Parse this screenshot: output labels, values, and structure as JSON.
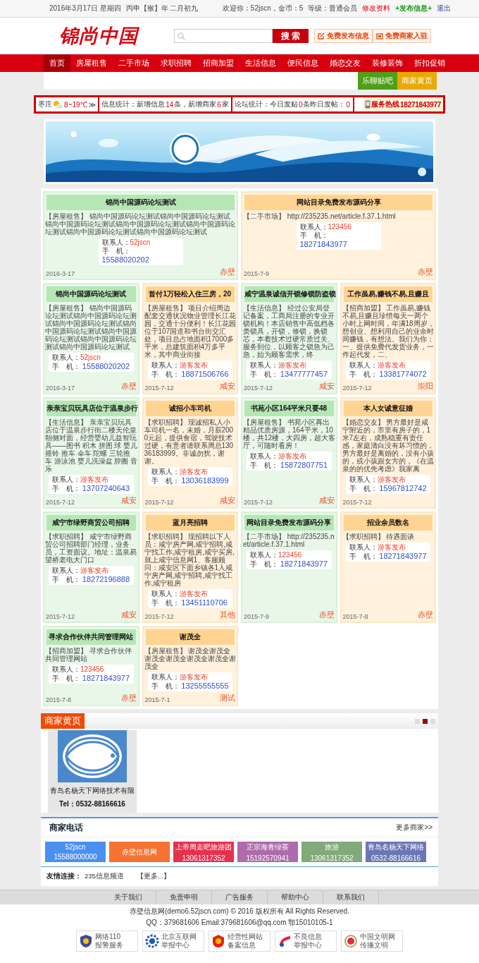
{
  "top_bar": {
    "date": "2016年3月17日 星期四",
    "lunar": "丙申【猴】年 二月初九",
    "welcome": "欢迎你：52jscn，金币：5",
    "level": "等级：普通会员",
    "links": [
      {
        "label": "修改资料",
        "kind": "edit"
      },
      {
        "label": "+发布信息+",
        "kind": "post"
      },
      {
        "label": "退出",
        "kind": "logout"
      }
    ]
  },
  "header": {
    "logo": "锦尚中国",
    "search_button": "搜 索",
    "actions": [
      {
        "label": "免费发布信息",
        "kind": "post"
      },
      {
        "label": "免费商家入驻",
        "kind": "shop"
      }
    ]
  },
  "nav": {
    "items": [
      {
        "label": "首页",
        "selected": true
      },
      {
        "label": "房屋租售",
        "selected": false
      },
      {
        "label": "二手市场",
        "selected": false
      },
      {
        "label": "求职招聘",
        "selected": false
      },
      {
        "label": "招商加盟",
        "selected": false
      },
      {
        "label": "生活信息",
        "selected": false
      },
      {
        "label": "便民信息",
        "selected": false
      },
      {
        "label": "婚恋交友",
        "selected": false
      },
      {
        "label": "装修装饰",
        "selected": false
      },
      {
        "label": "折扣促销",
        "selected": false
      }
    ]
  },
  "subnav": [
    {
      "label": "乐聊贴吧",
      "color": "#4f9f17"
    },
    {
      "label": "商家黄页",
      "color": "#e8aa00"
    }
  ],
  "stats": {
    "city": "枣庄",
    "temperature": "8~19℃",
    "more": "≫",
    "info_label": "信息统计：新增信息",
    "new_info": "14",
    "info_unit": "条，",
    "merchant_label": "新增商家",
    "new_merchants": "6",
    "merchant_unit": "家",
    "forum_label": "论坛统计：今日发贴",
    "today_posts": "0",
    "posts_unit": "条",
    "yesterday_label": "昨日发帖：",
    "yesterday_posts": "0",
    "hotline_label": "服务热线",
    "hotline": "18271843977"
  },
  "cards": [
    {
      "kind": "wide",
      "color": "#b6e6b6",
      "title": "锦尚中国源码论坛测试",
      "category": "【房屋租售】",
      "body": "锦尚中国源码论坛测试锦尚中国源码论坛测试锦尚中国源码论坛测试锦尚中国源码论坛测试锦尚中国源码论坛测试锦尚中国源码论坛测试锦尚中国源码论坛测试",
      "contact_label": "联系人：",
      "contact": "52jscn",
      "phone_label": "手　机：",
      "phone": "15588020202",
      "date": "2016-3-17",
      "area": "赤壁"
    },
    {
      "kind": "wide",
      "color": "#ffd391",
      "title": "网站目录免费发布源码分享",
      "category": "【二手市场】",
      "body": "http://235235.net/article.f.37.1.html",
      "contact_label": "联系人：",
      "contact": "123456",
      "phone_label": "手　机：",
      "phone": "18271843977",
      "date": "2015-7-9",
      "area": "赤壁"
    },
    {
      "kind": "normal",
      "color": "#b6e6b6",
      "title": "锦尚中国源码论坛测试",
      "category": "【房屋租售】",
      "body": "锦尚中国源码论坛测试锦尚中国源码论坛测试锦尚中国源码论坛测试锦尚中国源码论坛测试锦尚中国源码论坛测试锦尚中国源码论坛测试锦尚中国源码论坛测试",
      "contact_label": "联系人：",
      "contact": "52jscn",
      "phone_label": "手　机：",
      "phone": "15588020202",
      "date": "2016-3-17",
      "area": "赤壁"
    },
    {
      "kind": "normal",
      "color": "#ffd391",
      "title": "首付1万轻松入住三房，20",
      "category": "【房屋租售】",
      "body": "项目介绍周边配套交通状况物业管理长江花园，交通十分便利！长江花园位于107国道和书台街交汇处，项目总占地面积17000多平米，总建筑面积4万多平米，其中商业街接",
      "contact_label": "联系人：",
      "contact": "游客发布",
      "phone_label": "手　机：",
      "phone": "18871506766",
      "date": "2015-7-12",
      "area": "咸安"
    },
    {
      "kind": "normal",
      "color": "#b6e6b6",
      "title": "咸宁温泉诚信开锁修锁防盗锁",
      "category": "【生活信息】",
      "body": "经过公安局登记备案，工商局注册的专业开锁机构！本店销售中高低档各类锁具，开锁，修锁，换锁芯，本着技术过硬常质过关、服务到位，以顾客之锁急为己急，始为顾客需求，终",
      "contact_label": "联系人：",
      "contact": "游客发布",
      "phone_label": "手　机：",
      "phone": "13477777457",
      "date": "2015-7-12",
      "area": "咸安"
    },
    {
      "kind": "normal",
      "color": "#ffd391",
      "title": "工作虽易,赚钱不易,且赚且",
      "category": "【招商加盟】",
      "body": "工作虽易,赚钱不易,且赚且珍惜每天一两个小时上网时间，年满18周岁，想创业、想利用自己的业余时间赚钱，有想法。我们为你：一、提供免费代发货业务，一件起代发，二、",
      "contact_label": "联系人：",
      "contact": "游客发布",
      "phone_label": "手　机：",
      "phone": "13381774072",
      "date": "2015-7-12",
      "area": "崇阳"
    },
    {
      "kind": "normal",
      "color": "#b6e6b6",
      "title": "亲亲宝贝玩具店位于温泉步行",
      "category": "【生活信息】",
      "body": "亲亲宝贝玩具店位于温泉步行街二楼天伦皇朝侧对面，经营婴幼儿益智玩具——图书 积木 拼图 球 婴儿摇铃 推车 伞车 陀螺 三轮推车 游泳池 婴儿洗澡盆 脖圈 音乐",
      "contact_label": "联系人：",
      "contact": "游客发布",
      "phone_label": "手　机：",
      "phone": "13707240643",
      "date": "2015-7-12",
      "area": "咸安"
    },
    {
      "kind": "normal",
      "color": "#ffd391",
      "title": "诚招小车司机",
      "category": "【求职招聘】",
      "body": "现诚招私人小车司机一名，未婚，月薪2000元起，提供食宿，驾驶技术过硬，有意者请联系周总13036183999。非诚勿扰，谢谢。",
      "contact_label": "联系人：",
      "contact": "游客发布",
      "phone_label": "手　机：",
      "phone": "13036183999",
      "date": "2015-7-12",
      "area": "咸安"
    },
    {
      "kind": "normal",
      "color": "#b6e6b6",
      "title": "书苑小区164平米只要48",
      "category": "【房屋租售】",
      "body": "书苑小区再出精品优质房源，164平米，10楼，共12楼，大四房，超大客厅，可随时看房！",
      "contact_label": "联系人：",
      "contact": "游客发布",
      "phone_label": "手　机：",
      "phone": "15872807751",
      "date": "2015-7-12",
      "area": "咸安"
    },
    {
      "kind": "normal",
      "color": "#ffd391",
      "title": "本人女诚意征婚",
      "category": "【婚恋交友】",
      "body": "男方最好是咸宁附近的，市里有房子的，1米7左右，成熟稳重有责任感，家庭清白没有坏习惯的，男方最好是离婚的，没有小孩的，或小孩跟女方的，《在温泉的的优先考虑》我家离",
      "contact_label": "联系人：",
      "contact": "游客发布",
      "phone_label": "手　机：",
      "phone": "15967812742",
      "date": "2015-7-12"
    },
    {
      "kind": "normal",
      "color": "#b6e6b6",
      "title": "咸宁市绿野商贸公司招聘",
      "category": "【求职招聘】",
      "body": "咸宁市绿野商贸公司招聘部门经理，业务员，工资面议。地址：温泉易望桥老电大门口",
      "contact_label": "联系人：",
      "contact": "游客发布",
      "phone_label": "手　机：",
      "phone": "18272196888",
      "date": "2015-7-12",
      "area": "咸安"
    },
    {
      "kind": "normal",
      "color": "#ffd391",
      "title": "蓝月亮招聘",
      "category": "【求职招聘】",
      "body": "现招聘以下人员：咸宁房产网,咸宁招聘,咸宁找工作,咸宁租房,咸宁买房,就上咸宁信息网1、客服顾问：咸安区下面乡镇各1人咸宁房产网,咸宁招聘,咸宁找工作,咸宁租房",
      "contact_label": "联系人：",
      "contact": "游客发布",
      "phone_label": "手　机：",
      "phone": "13451110706",
      "date": "2015-7-12",
      "area": "其他"
    },
    {
      "kind": "normal",
      "color": "#b6e6b6",
      "title": "网站目录免费发布源码分享",
      "category": "【二手市场】",
      "body": "http://235235.net/article.f.37.1.html",
      "contact_label": "联系人：",
      "contact": "123456",
      "phone_label": "手　机：",
      "phone": "18271843977",
      "date": "2015-7-9",
      "area": "赤壁"
    },
    {
      "kind": "normal",
      "color": "#ffd391",
      "title": "招业余员数名",
      "category": "【求职招聘】",
      "body": "待遇面谈",
      "contact_label": "联系人：",
      "contact": "游客发布",
      "phone_label": "手　机：",
      "phone": "18271843977",
      "date": "2015-7-8",
      "area": "赤壁"
    },
    {
      "kind": "normal",
      "color": "#b6e6b6",
      "title": "寻求合作伙伴共同管理网站",
      "category": "【招商加盟】",
      "body": "寻求合作伙伴共同管理网站",
      "contact_label": "联系人：",
      "contact": "123456",
      "phone_label": "手　机：",
      "phone": "18271843977",
      "date": "2015-7-8",
      "area": "赤壁"
    },
    {
      "kind": "normal",
      "color": "#ffd391",
      "title": "谢茂全",
      "category": "【房屋租售】",
      "body": "谢茂全谢茂全谢茂全谢茂全谢茂全谢茂全谢茂全",
      "contact_label": "联系人：",
      "contact": "游客发布",
      "phone_label": "手　机：",
      "phone": "13255555555",
      "date": "2015-7-1",
      "area": "测试"
    }
  ],
  "merchants": {
    "title": "商家黄页",
    "pager": [
      {
        "selected": false
      },
      {
        "selected": true
      },
      {
        "selected": false
      }
    ],
    "companies": [
      {
        "name": "青岛名杨天下网络技术有限",
        "tel": "Tel：0532-88166616"
      }
    ]
  },
  "phones": {
    "title": "商家电话",
    "more": "更多商家>>",
    "tiles": [
      {
        "name": "52jscn",
        "phone": "15588000000",
        "color": "#4a90f0"
      },
      {
        "name": "赤壁信息网",
        "color": "#f57332"
      },
      {
        "name": "上帝周走吧旅游团",
        "phone": "13061317352",
        "color": "#e8304e"
      },
      {
        "name": "正宗海青绿茶",
        "phone": "15192570941",
        "color": "#ad6bab"
      },
      {
        "name": "旅游",
        "phone": "13061317352",
        "color": "#82a97a"
      },
      {
        "name": "青岛名杨天下网络",
        "phone": "0532-88166616",
        "color": "#6b77b5"
      }
    ]
  },
  "friend_links": {
    "label": "友情连接：",
    "links": [
      "235信息频道"
    ],
    "more": "【更多...】"
  },
  "footer": {
    "links": [
      "关于我们",
      "免责申明",
      "广告服务",
      "帮助中心",
      "联系我们"
    ],
    "copyright": "赤壁信息网(demo6.52jscn.com) © 2016 版权所有 All Rights Reserved.",
    "contact": "QQ：379681606 Email:379681606@qq.com 鄂15010105-1",
    "badges": [
      {
        "kind": "police",
        "line1": "网络110",
        "line2": "报警服务"
      },
      {
        "kind": "report",
        "line1": "北京互联网",
        "line2": "举报中心"
      },
      {
        "kind": "record",
        "line1": "经营性网站",
        "line2": "备案信息"
      },
      {
        "kind": "bad",
        "line1": "不良信息",
        "line2": "举报中心"
      },
      {
        "kind": "civil",
        "line1": "中国文明网",
        "line2": "传播文明"
      }
    ]
  }
}
